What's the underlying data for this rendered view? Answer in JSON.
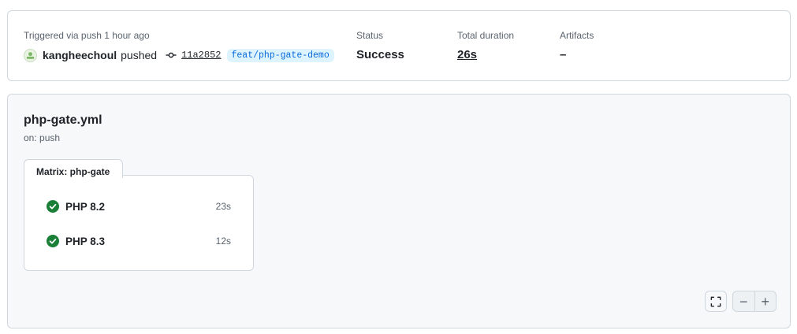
{
  "run": {
    "trigger_label": "Triggered via push 1 hour ago",
    "username": "kangheechoul",
    "action": "pushed",
    "commit_sha": "11a2852",
    "branch": "feat/php-gate-demo",
    "avatar_icon": "user-avatar"
  },
  "meta": {
    "status_label": "Status",
    "status_value": "Success",
    "duration_label": "Total duration",
    "duration_value": "26s",
    "artifacts_label": "Artifacts",
    "artifacts_value": "–"
  },
  "workflow": {
    "name": "php-gate.yml",
    "trigger": "on: push",
    "matrix_label": "Matrix: php-gate",
    "jobs": [
      {
        "name": "PHP 8.2",
        "duration": "23s",
        "status": "success",
        "icon": "check-circle-fill-icon"
      },
      {
        "name": "PHP 8.3",
        "duration": "12s",
        "status": "success",
        "icon": "check-circle-fill-icon"
      }
    ]
  },
  "controls": {
    "zoom_out_label": "−",
    "zoom_in_label": "+",
    "fullscreen_icon": "fullscreen-icon"
  },
  "colors": {
    "success": "#1a7f37",
    "link": "#0969da",
    "branch_bg": "#ddf4ff",
    "panel_bg": "#f6f8fa"
  }
}
